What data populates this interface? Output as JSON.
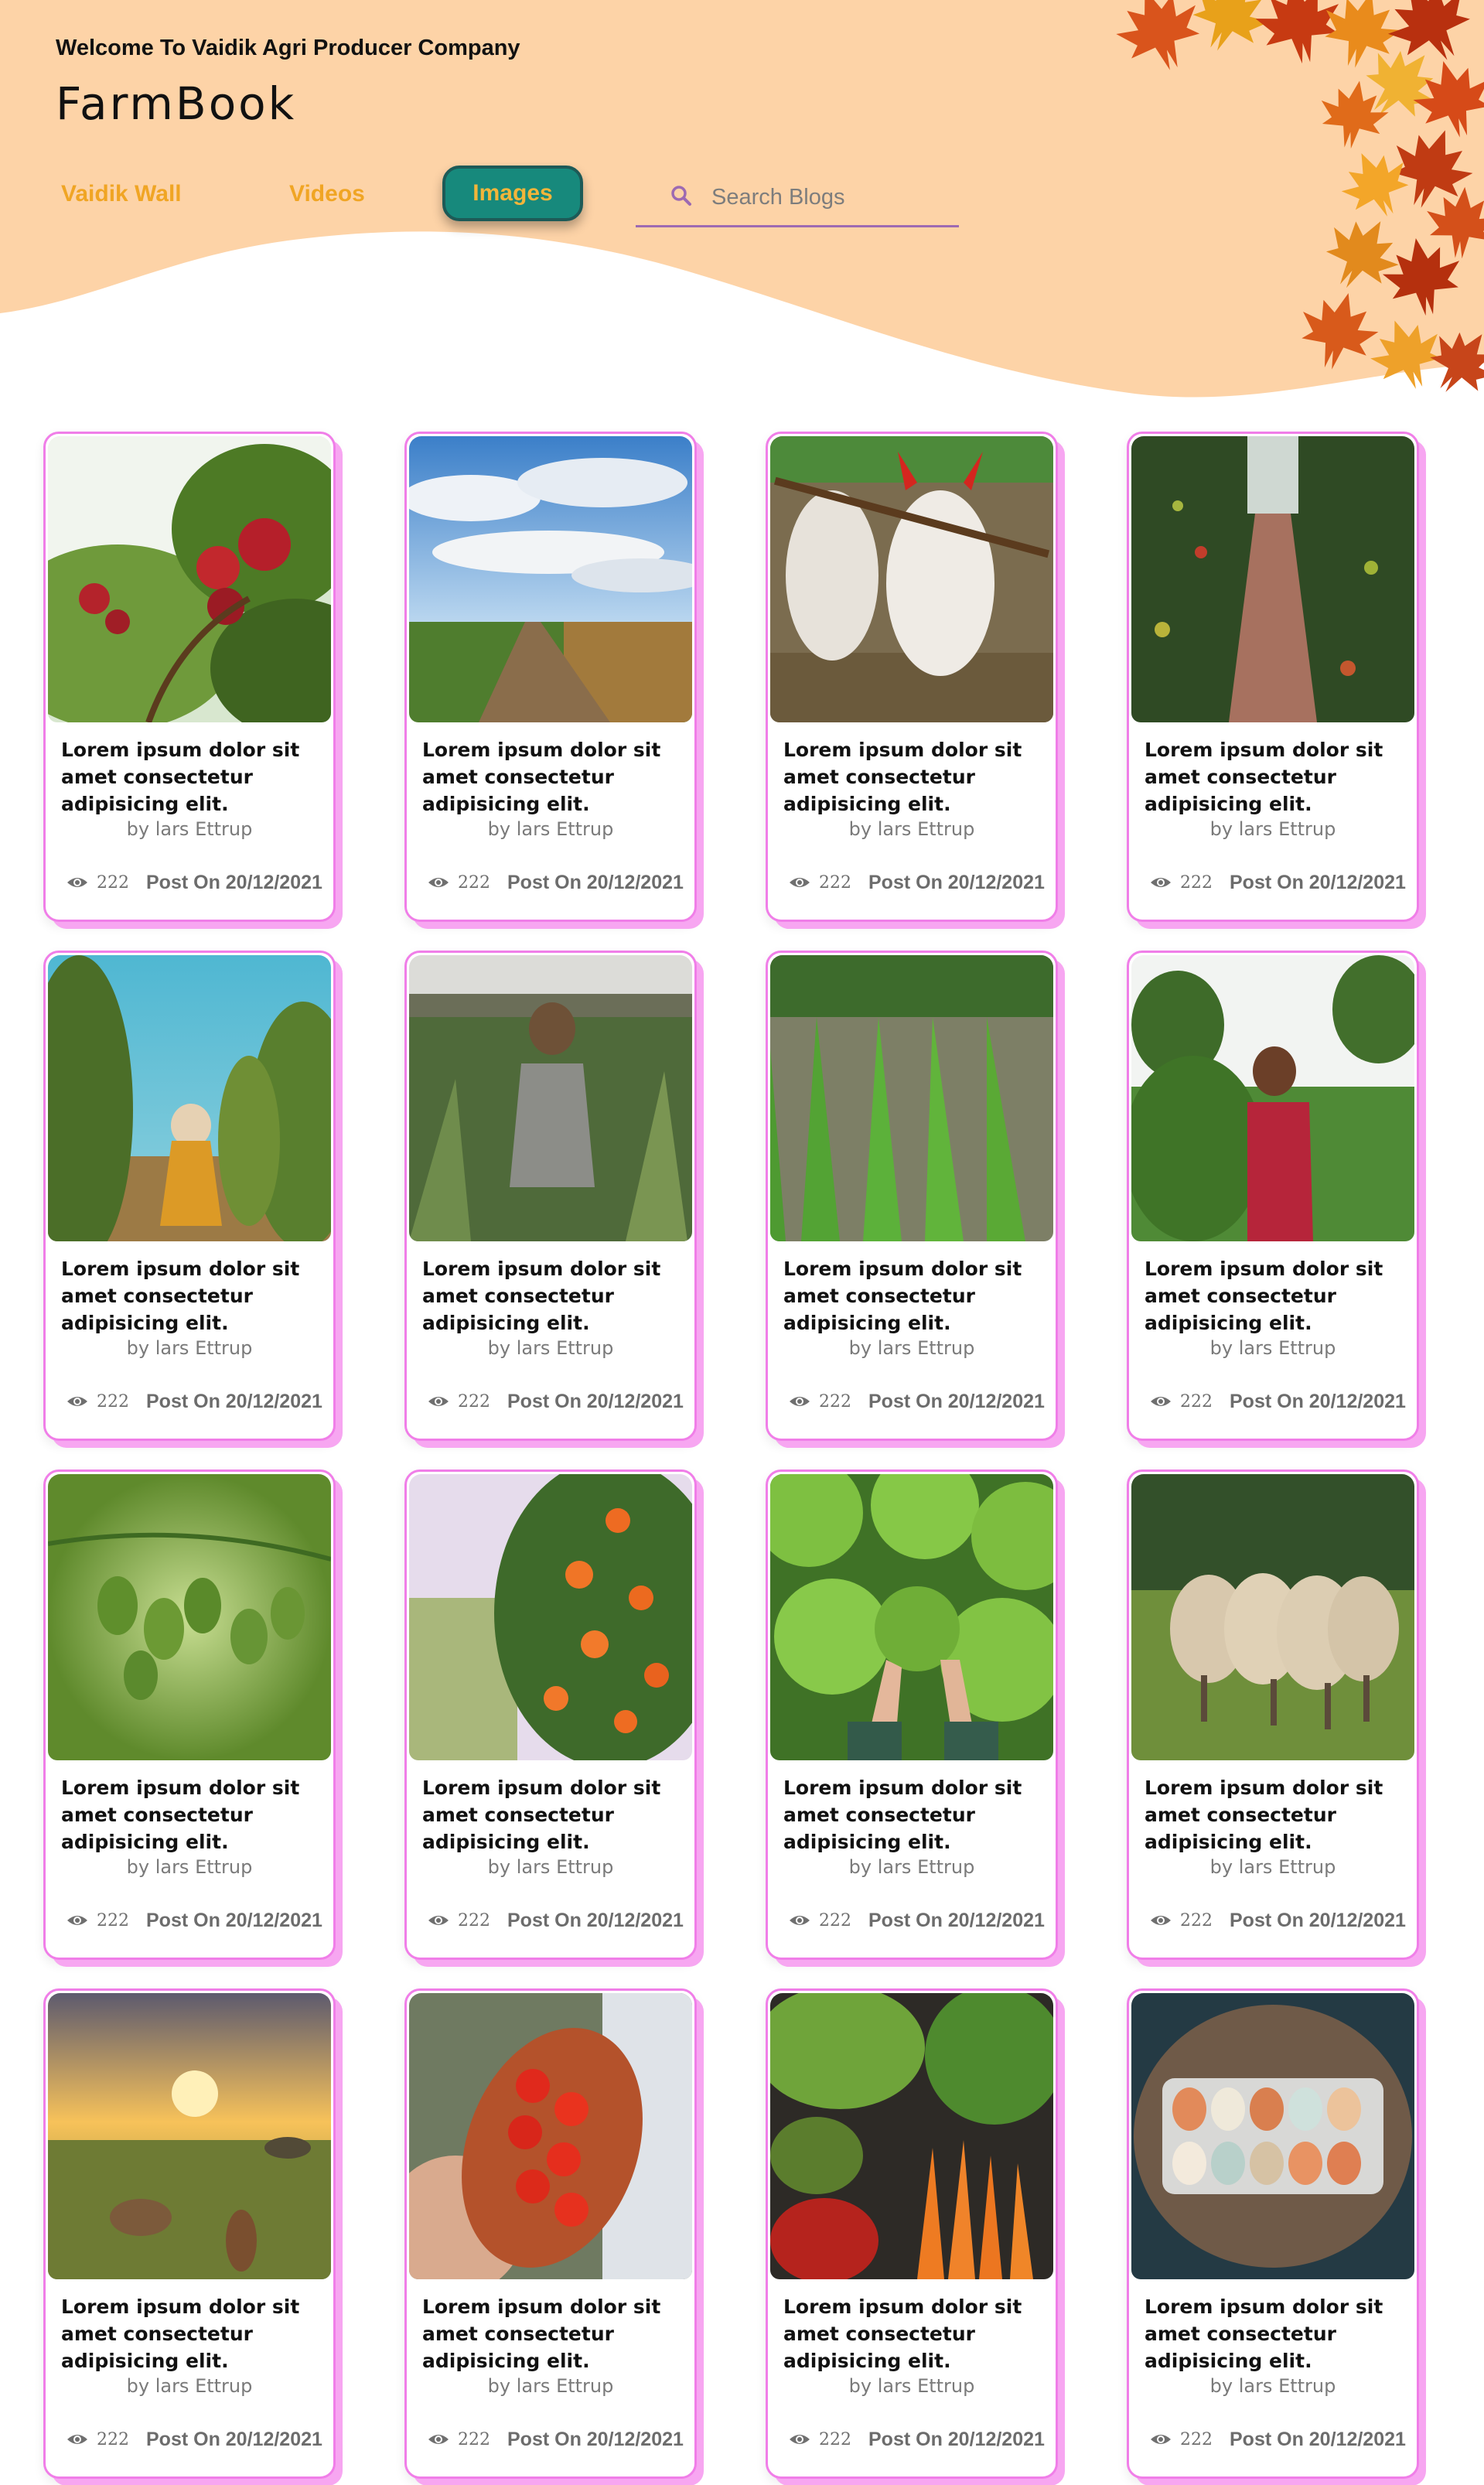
{
  "header": {
    "welcome": "Welcome To Vaidik Agri Producer Company",
    "brand": "FarmBook",
    "colors": {
      "band": "#fdd3a7",
      "nav_text": "#f0a524",
      "active_bg": "#17897c",
      "search_line": "#9d6ab2"
    }
  },
  "nav": {
    "items": [
      {
        "label": "Vaidik Wall",
        "active": false
      },
      {
        "label": "Videos",
        "active": false
      },
      {
        "label": "Images",
        "active": true
      }
    ]
  },
  "search": {
    "icon": "search-icon",
    "placeholder": "Search Blogs",
    "value": ""
  },
  "cards": [
    {
      "image": "apple tree",
      "title": "Lorem ipsum dolor sit amet consectetur adipisicing elit.",
      "author": "by lars Ettrup",
      "views": "222",
      "date": "Post On 20/12/2021"
    },
    {
      "image": "field road sky",
      "title": "Lorem ipsum dolor sit amet consectetur adipisicing elit.",
      "author": "by lars Ettrup",
      "views": "222",
      "date": "Post On 20/12/2021"
    },
    {
      "image": "bulls",
      "title": "Lorem ipsum dolor sit amet consectetur adipisicing elit.",
      "author": "by lars Ettrup",
      "views": "222",
      "date": "Post On 20/12/2021"
    },
    {
      "image": "tomato rows",
      "title": "Lorem ipsum dolor sit amet consectetur adipisicing elit.",
      "author": "by lars Ettrup",
      "views": "222",
      "date": "Post On 20/12/2021"
    },
    {
      "image": "vineyard woman",
      "title": "Lorem ipsum dolor sit amet consectetur adipisicing elit.",
      "author": "by lars Ettrup",
      "views": "222",
      "date": "Post On 20/12/2021"
    },
    {
      "image": "corn field",
      "title": "Lorem ipsum dolor sit amet consectetur adipisicing elit.",
      "author": "by lars Ettrup",
      "views": "222",
      "date": "Post On 20/12/2021"
    },
    {
      "image": "rice paddy",
      "title": "Lorem ipsum dolor sit amet consectetur adipisicing elit.",
      "author": "by lars Ettrup",
      "views": "222",
      "date": "Post On 20/12/2021"
    },
    {
      "image": "farmer woman",
      "title": "Lorem ipsum dolor sit amet consectetur adipisicing elit.",
      "author": "by lars Ettrup",
      "views": "222",
      "date": "Post On 20/12/2021"
    },
    {
      "image": "green tomatoes",
      "title": "Lorem ipsum dolor sit amet consectetur adipisicing elit.",
      "author": "by lars Ettrup",
      "views": "222",
      "date": "Post On 20/12/2021"
    },
    {
      "image": "orange tree",
      "title": "Lorem ipsum dolor sit amet consectetur adipisicing elit.",
      "author": "by lars Ettrup",
      "views": "222",
      "date": "Post On 20/12/2021"
    },
    {
      "image": "lettuce",
      "title": "Lorem ipsum dolor sit amet consectetur adipisicing elit.",
      "author": "by lars Ettrup",
      "views": "222",
      "date": "Post On 20/12/2021"
    },
    {
      "image": "sheep",
      "title": "Lorem ipsum dolor sit amet consectetur adipisicing elit.",
      "author": "by lars Ettrup",
      "views": "222",
      "date": "Post On 20/12/2021"
    },
    {
      "image": "sunset horses",
      "title": "Lorem ipsum dolor sit amet consectetur adipisicing elit.",
      "author": "by lars Ettrup",
      "views": "222",
      "date": "Post On 20/12/2021"
    },
    {
      "image": "tomato bowl",
      "title": "Lorem ipsum dolor sit amet consectetur adipisicing elit.",
      "author": "by lars Ettrup",
      "views": "222",
      "date": "Post On 20/12/2021"
    },
    {
      "image": "vegetables",
      "title": "Lorem ipsum dolor sit amet consectetur adipisicing elit.",
      "author": "by lars Ettrup",
      "views": "222",
      "date": "Post On 20/12/2021"
    },
    {
      "image": "eggs",
      "title": "Lorem ipsum dolor sit amet consectetur adipisicing elit.",
      "author": "by lars Ettrup",
      "views": "222",
      "date": "Post On 20/12/2021"
    }
  ]
}
